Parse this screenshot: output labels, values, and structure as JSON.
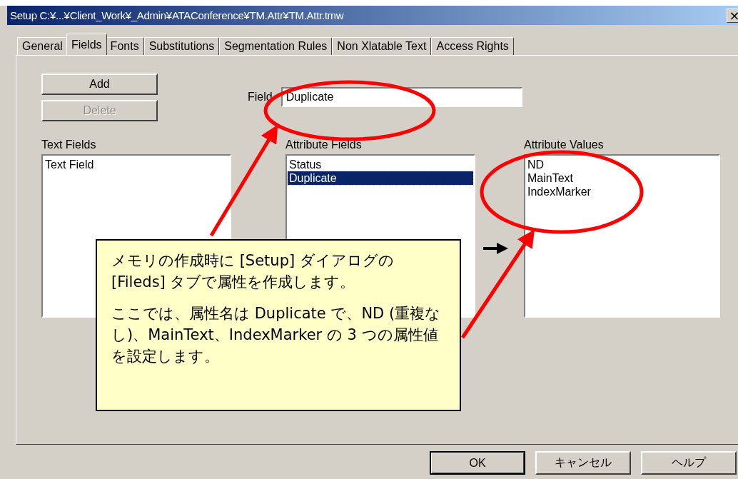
{
  "window": {
    "title": "Setup C:¥...¥Client_Work¥_Admin¥ATAConference¥TM.Attr¥TM.Attr.tmw",
    "close": "×"
  },
  "tabs": [
    {
      "label": "General",
      "selected": false
    },
    {
      "label": "Fields",
      "selected": true
    },
    {
      "label": "Fonts",
      "selected": false
    },
    {
      "label": "Substitutions",
      "selected": false
    },
    {
      "label": "Segmentation Rules",
      "selected": false
    },
    {
      "label": "Non Xlatable Text",
      "selected": false
    },
    {
      "label": "Access Rights",
      "selected": false
    }
  ],
  "side_buttons": [
    {
      "label": "Add",
      "disabled": false
    },
    {
      "label": "Delete",
      "disabled": true
    }
  ],
  "field": {
    "label": "Field",
    "value": "Duplicate"
  },
  "lists": [
    {
      "label": "Text Fields",
      "items": [
        {
          "text": "Text Field",
          "selected": false
        }
      ]
    },
    {
      "label": "Attribute Fields",
      "items": [
        {
          "text": "Status",
          "selected": false
        },
        {
          "text": "Duplicate",
          "selected": true
        }
      ]
    },
    {
      "label": "Attribute Values",
      "items": [
        {
          "text": "ND",
          "selected": false
        },
        {
          "text": "MainText",
          "selected": false
        },
        {
          "text": "IndexMarker",
          "selected": false
        }
      ]
    }
  ],
  "callout": {
    "paragraphs": [
      "メモリの作成時に [Setup] ダイアログの [Fileds] タブで属性を作成します。",
      "ここでは、属性名は Duplicate で、ND (重複なし)、MainText、IndexMarker の 3 つの属性値を設定します。"
    ]
  },
  "dialog_buttons": [
    {
      "label": "OK",
      "default": true
    },
    {
      "label": "キャンセル",
      "default": false
    },
    {
      "label": "ヘルプ",
      "default": false
    }
  ]
}
